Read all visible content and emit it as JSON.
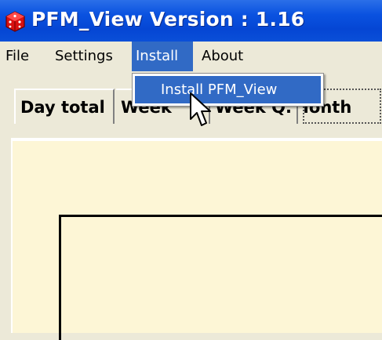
{
  "window": {
    "title": "PFM_View Version :  1.16"
  },
  "menu": {
    "items": [
      {
        "label": "File"
      },
      {
        "label": "Settings"
      },
      {
        "label": "Install"
      },
      {
        "label": "About"
      }
    ],
    "open_dropdown": {
      "items": [
        {
          "label": "Install PFM_View"
        }
      ]
    }
  },
  "tabs": [
    {
      "label": "Day total"
    },
    {
      "label": "Week"
    },
    {
      "label": "Week Q."
    },
    {
      "label": "Month"
    }
  ],
  "colors": {
    "titlebar": "#0a52e0",
    "highlight": "#316ac5",
    "panel_bg": "#fdf6d6",
    "chrome": "#ece9d8"
  }
}
